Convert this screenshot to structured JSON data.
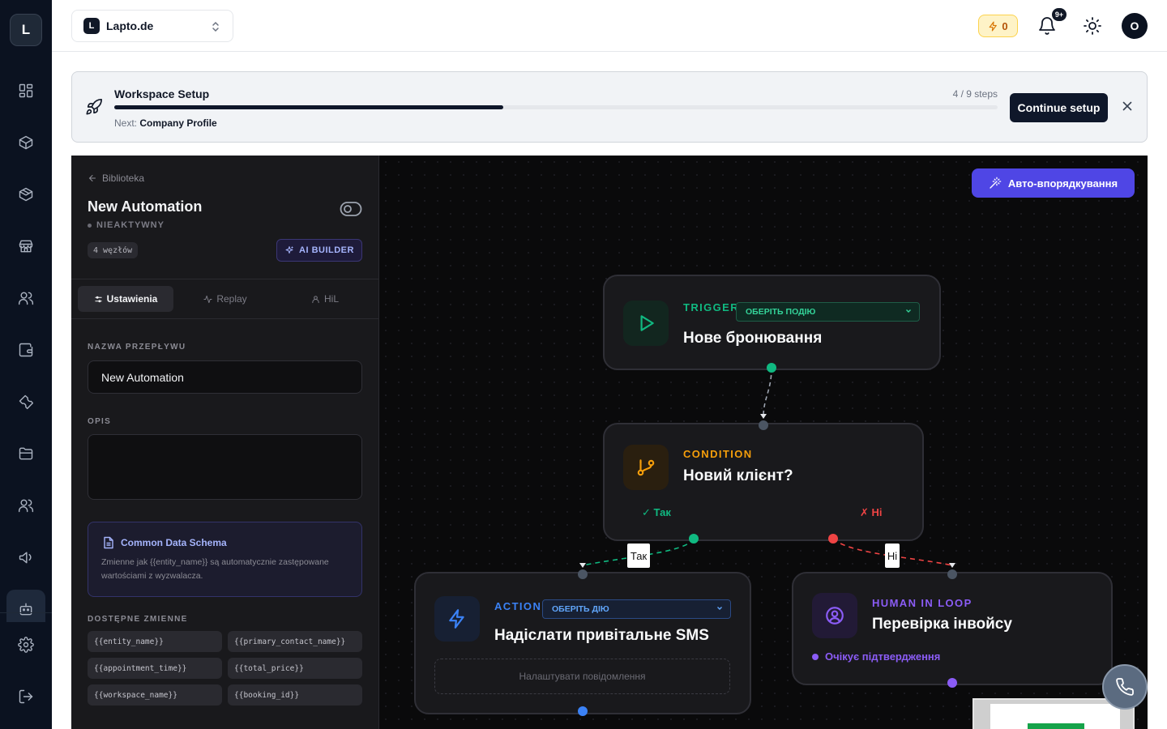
{
  "rail": {
    "logo": "L",
    "icons": [
      "dashboard-icon",
      "box-icon",
      "package-icon",
      "store-icon",
      "users-icon",
      "wallet-icon",
      "wrench-icon",
      "folder-icon",
      "team-icon",
      "megaphone-icon",
      "automation-icon",
      "settings-icon",
      "logout-icon"
    ]
  },
  "header": {
    "workspace_badge": "L",
    "workspace_name": "Lapto.de",
    "credits": "0",
    "notifications_badge": "9+",
    "avatar_initial": "O"
  },
  "setup_banner": {
    "title": "Workspace Setup",
    "steps": "4 / 9 steps",
    "progress_fraction": 0.44,
    "next_label": "Next:",
    "next_value": "Company Profile",
    "continue_label": "Continue setup"
  },
  "panel": {
    "back_label": "Biblioteka",
    "flow_title": "New Automation",
    "status": "NIEAKTYWNY",
    "node_count": "4 węzłów",
    "ai_builder_label": "AI BUILDER",
    "tabs": [
      {
        "label": "Ustawienia",
        "active": true
      },
      {
        "label": "Replay",
        "active": false
      },
      {
        "label": "HiL",
        "active": false
      }
    ],
    "name_label": "NAZWA PRZEPŁYWU",
    "name_value": "New Automation",
    "description_label": "OPIS",
    "description_value": "",
    "schema_title": "Common Data Schema",
    "schema_text": "Zmienne jak {{entity_name}} są automatycznie zastępowane wartościami z wyzwalacza.",
    "variables_label": "DOSTĘPNE ZMIENNE",
    "variables": [
      "{{entity_name}}",
      "{{primary_contact_name}}",
      "{{appointment_time}}",
      "{{total_price}}",
      "{{workspace_name}}",
      "{{booking_id}}"
    ]
  },
  "canvas": {
    "arrange_label": "Авто-впорядкування",
    "nodes": {
      "trigger": {
        "kind": "TRIGGER",
        "select": "ОБЕРІТЬ ПОДІЮ",
        "title": "Нове бронювання",
        "color": "#10b981"
      },
      "condition": {
        "kind": "CONDITION",
        "title": "Новий клієнт?",
        "yes": "✓ Так",
        "no": "✗ Ні",
        "color": "#f59e0b"
      },
      "action": {
        "kind": "ACTION",
        "select": "ОБЕРІТЬ ДІЮ",
        "title": "Надіслати привітальне SMS",
        "message_placeholder": "Налаштувати повідомлення",
        "color": "#3b82f6"
      },
      "human": {
        "kind": "HUMAN IN LOOP",
        "title": "Перевірка інвойсу",
        "status": "Очікує підтвердження",
        "color": "#8b5cf6"
      }
    },
    "edge_labels": {
      "yes": "Так",
      "no": "Ні"
    }
  }
}
